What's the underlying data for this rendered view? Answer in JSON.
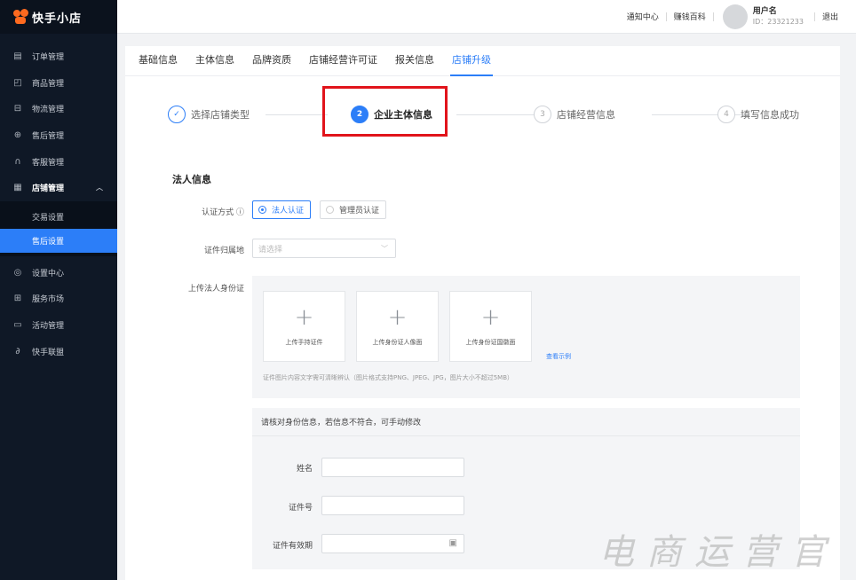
{
  "app": {
    "name": "快手小店"
  },
  "topbar": {
    "links": [
      "通知中心",
      "赚钱百科"
    ],
    "user_name": "用户名",
    "user_id": "ID：23321233",
    "logout": "退出"
  },
  "sidebar": {
    "items_top": [
      {
        "label": "订单管理",
        "icon": "order-icon"
      },
      {
        "label": "商品管理",
        "icon": "bag-icon"
      },
      {
        "label": "物流管理",
        "icon": "truck-icon"
      },
      {
        "label": "售后管理",
        "icon": "aftersale-icon"
      },
      {
        "label": "客服管理",
        "icon": "headset-icon"
      }
    ],
    "open_item": {
      "label": "店铺管理",
      "icon": "store-icon"
    },
    "sub_items": [
      {
        "label": "交易设置",
        "active": false
      },
      {
        "label": "售后设置",
        "active": true
      }
    ],
    "items_bottom": [
      {
        "label": "设置中心",
        "icon": "settings-icon"
      },
      {
        "label": "服务市场",
        "icon": "grid-icon"
      },
      {
        "label": "活动管理",
        "icon": "activity-icon"
      },
      {
        "label": "快手联盟",
        "icon": "link-icon"
      }
    ]
  },
  "tabs": [
    {
      "label": "基础信息",
      "active": false
    },
    {
      "label": "主体信息",
      "active": false
    },
    {
      "label": "品牌资质",
      "active": false
    },
    {
      "label": "店铺经营许可证",
      "active": false
    },
    {
      "label": "报关信息",
      "active": false
    },
    {
      "label": "店铺升级",
      "active": true
    }
  ],
  "steps": [
    {
      "num": "✓",
      "label": "选择店铺类型",
      "state": "done"
    },
    {
      "num": "2",
      "label": "企业主体信息",
      "state": "current"
    },
    {
      "num": "3",
      "label": "店铺经营信息",
      "state": "pending"
    },
    {
      "num": "4",
      "label": "填写信息成功",
      "state": "pending"
    }
  ],
  "form": {
    "section_title": "法人信息",
    "auth_label": "认证方式 ⓘ",
    "auth_options": [
      "法人认证",
      "管理员认证"
    ],
    "auth_selected": "法人认证",
    "region_label": "证件归属地",
    "region_placeholder": "请选择",
    "upload_label": "上传法人身份证",
    "upload_cards": [
      "上传手持证件",
      "上传身份证人像面",
      "上传身份证国徽面"
    ],
    "example_link": "查看示例",
    "upload_hint": "证件图片内容文字需可清晰辨认（图片格式支持PNG、JPEG、JPG，图片大小不超过5MB）",
    "verify_title": "请核对身份信息，若信息不符合，可手动修改",
    "name_label": "姓名",
    "id_label": "证件号",
    "validity_label": "证件有效期"
  },
  "watermark": "电商运营官",
  "colors": {
    "accent": "#2c7ef8",
    "sidebar_bg": "#0f1826",
    "highlight": "#e1141b",
    "brand": "#fe6a1f"
  }
}
